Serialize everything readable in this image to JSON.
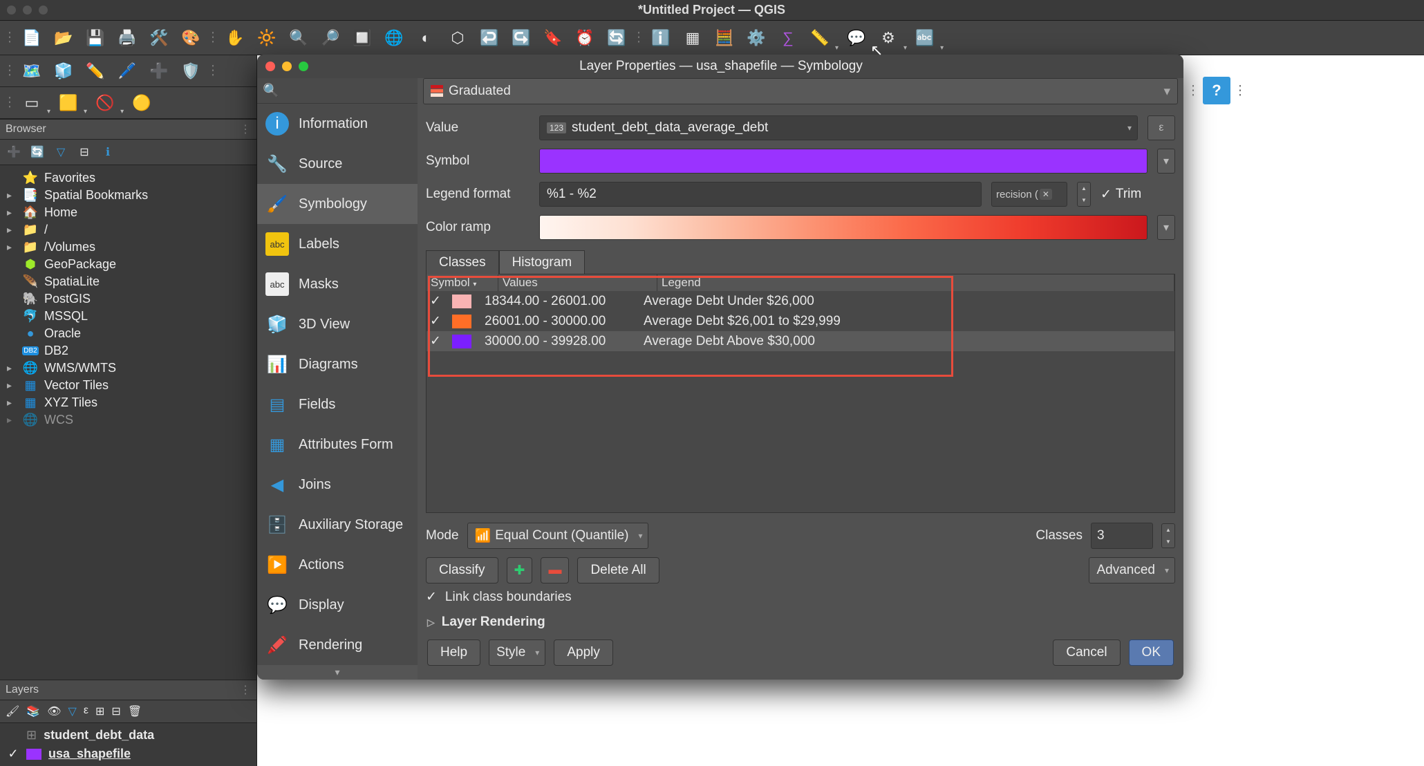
{
  "titlebar": {
    "title": "*Untitled Project — QGIS"
  },
  "browser_panel": {
    "title": "Browser",
    "items": [
      {
        "label": "Favorites",
        "icon": "⭐",
        "expandable": false
      },
      {
        "label": "Spatial Bookmarks",
        "icon": "📑",
        "expandable": true
      },
      {
        "label": "Home",
        "icon": "🏠",
        "expandable": true
      },
      {
        "label": "/",
        "icon": "📁",
        "expandable": true
      },
      {
        "label": "/Volumes",
        "icon": "📁",
        "expandable": true
      },
      {
        "label": "GeoPackage",
        "icon": "📦",
        "expandable": false
      },
      {
        "label": "SpatiaLite",
        "icon": "🪶",
        "expandable": false
      },
      {
        "label": "PostGIS",
        "icon": "🐘",
        "expandable": false
      },
      {
        "label": "MSSQL",
        "icon": "🐬",
        "expandable": false
      },
      {
        "label": "Oracle",
        "icon": "🔵",
        "expandable": false
      },
      {
        "label": "DB2",
        "icon": "🟦",
        "expandable": false
      },
      {
        "label": "WMS/WMTS",
        "icon": "🌐",
        "expandable": true
      },
      {
        "label": "Vector Tiles",
        "icon": "▦",
        "expandable": true
      },
      {
        "label": "XYZ Tiles",
        "icon": "▦",
        "expandable": true
      },
      {
        "label": "WCS",
        "icon": "🌐",
        "expandable": true
      }
    ]
  },
  "layers_panel": {
    "title": "Layers",
    "items": [
      {
        "checked": false,
        "swatch": "none",
        "label": "student_debt_data",
        "icon": "⊞"
      },
      {
        "checked": true,
        "swatch": "#9a33ff",
        "label": "usa_shapefile",
        "underline": true
      }
    ]
  },
  "dialog": {
    "title": "Layer Properties — usa_shapefile — Symbology",
    "sidebar": [
      {
        "label": "Information",
        "icon": "ℹ️"
      },
      {
        "label": "Source",
        "icon": "🔧"
      },
      {
        "label": "Symbology",
        "icon": "🖌️",
        "active": true
      },
      {
        "label": "Labels",
        "icon": "abc"
      },
      {
        "label": "Masks",
        "icon": "abc"
      },
      {
        "label": "3D View",
        "icon": "🧊"
      },
      {
        "label": "Diagrams",
        "icon": "📊"
      },
      {
        "label": "Fields",
        "icon": "▤"
      },
      {
        "label": "Attributes Form",
        "icon": "▦"
      },
      {
        "label": "Joins",
        "icon": "🔗"
      },
      {
        "label": "Auxiliary Storage",
        "icon": "🗄️"
      },
      {
        "label": "Actions",
        "icon": "▶️"
      },
      {
        "label": "Display",
        "icon": "💬"
      },
      {
        "label": "Rendering",
        "icon": "🖍️"
      }
    ],
    "symbology_type": "Graduated",
    "value_field": "student_debt_data_average_debt",
    "legend_format": "%1 - %2",
    "precision_label": "recision (",
    "trim_label": "Trim",
    "tabs": {
      "classes": "Classes",
      "histogram": "Histogram"
    },
    "class_headers": {
      "symbol": "Symbol",
      "values": "Values",
      "legend": "Legend"
    },
    "classes": [
      {
        "checked": true,
        "color": "#f9b3b3",
        "values": "18344.00 - 26001.00",
        "legend": "Average Debt Under $26,000"
      },
      {
        "checked": true,
        "color": "#ff6e27",
        "values": "26001.00 - 30000.00",
        "legend": "Average Debt $26,001 to $29,999"
      },
      {
        "checked": true,
        "color": "#7b1fff",
        "values": "30000.00 - 39928.00",
        "legend": "Average Debt Above $30,000",
        "selected": true
      }
    ],
    "mode": {
      "label": "Mode",
      "value": "Equal Count (Quantile)"
    },
    "classes_count": {
      "label": "Classes",
      "value": "3"
    },
    "buttons": {
      "classify": "Classify",
      "delete_all": "Delete All",
      "advanced": "Advanced",
      "link": "Link class boundaries",
      "layer_rendering": "Layer Rendering",
      "help": "Help",
      "style": "Style",
      "apply": "Apply",
      "cancel": "Cancel",
      "ok": "OK"
    },
    "labels": {
      "value": "Value",
      "symbol": "Symbol",
      "legend_format": "Legend format",
      "color_ramp": "Color ramp"
    }
  }
}
